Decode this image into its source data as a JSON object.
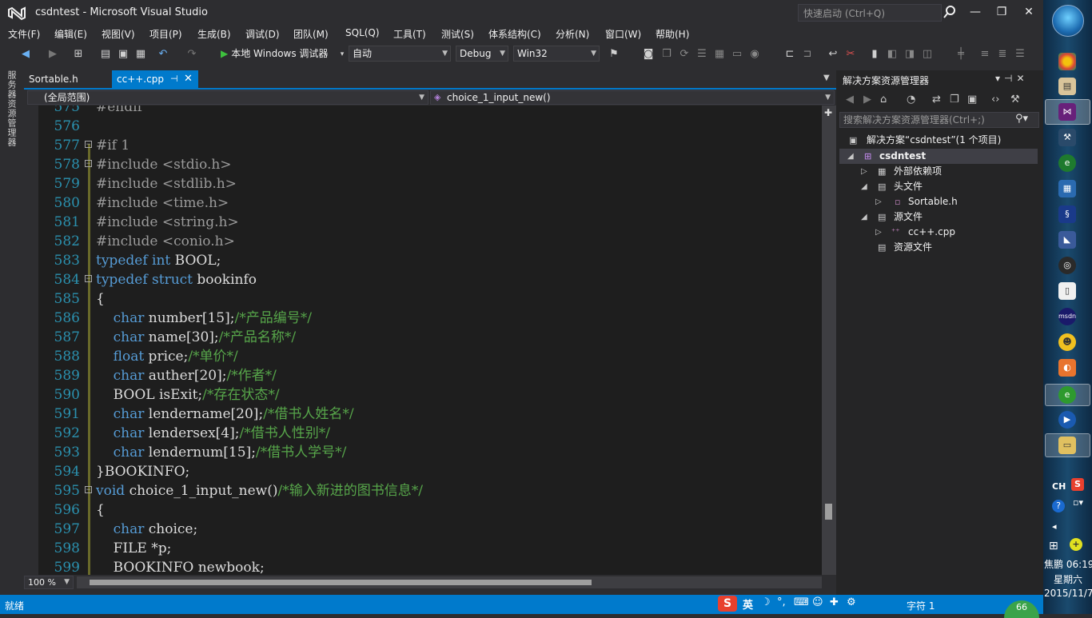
{
  "window": {
    "title": "csdntest - Microsoft Visual Studio",
    "quick_launch_placeholder": "快速启动 (Ctrl+Q)",
    "minimize": "—",
    "restore": "❐",
    "close": "✕"
  },
  "menu": [
    "文件(F)",
    "编辑(E)",
    "视图(V)",
    "项目(P)",
    "生成(B)",
    "调试(D)",
    "团队(M)",
    "SQL(Q)",
    "工具(T)",
    "测试(S)",
    "体系结构(C)",
    "分析(N)",
    "窗口(W)",
    "帮助(H)"
  ],
  "toolbar": {
    "run_label": "本地 Windows 调试器",
    "config_auto": "自动",
    "config_debug": "Debug",
    "config_platform": "Win32"
  },
  "left_strip": {
    "server_explorer": "服务器资源管理器"
  },
  "tabs": [
    {
      "label": "Sortable.h",
      "active": false
    },
    {
      "label": "cc++.cpp",
      "active": true
    }
  ],
  "nav": {
    "scope": "(全局范围)",
    "member": "choice_1_input_new()"
  },
  "code_lines": [
    {
      "num": "575",
      "fold": "",
      "tokens": [
        {
          "t": "#endif",
          "c": "pp"
        }
      ]
    },
    {
      "num": "576",
      "fold": "",
      "tokens": []
    },
    {
      "num": "577",
      "fold": "⊟",
      "tokens": [
        {
          "t": "#if",
          "c": "pp"
        },
        {
          "t": " 1",
          "c": "pp"
        }
      ]
    },
    {
      "num": "578",
      "fold": "⊟",
      "tokens": [
        {
          "t": "#include",
          "c": "pp"
        },
        {
          "t": " <stdio.h>",
          "c": "tr"
        }
      ]
    },
    {
      "num": "579",
      "fold": "",
      "tokens": [
        {
          "t": "#include",
          "c": "pp"
        },
        {
          "t": " <stdlib.h>",
          "c": "tr"
        }
      ]
    },
    {
      "num": "580",
      "fold": "",
      "tokens": [
        {
          "t": "#include",
          "c": "pp"
        },
        {
          "t": " <time.h>",
          "c": "tr"
        }
      ]
    },
    {
      "num": "581",
      "fold": "",
      "tokens": [
        {
          "t": "#include",
          "c": "pp"
        },
        {
          "t": " <string.h>",
          "c": "tr"
        }
      ]
    },
    {
      "num": "582",
      "fold": "",
      "tokens": [
        {
          "t": "#include",
          "c": "pp"
        },
        {
          "t": " <conio.h>",
          "c": "tr"
        }
      ]
    },
    {
      "num": "583",
      "fold": "",
      "tokens": [
        {
          "t": "typedef",
          "c": "kw"
        },
        {
          "t": " ",
          "c": "tx"
        },
        {
          "t": "int",
          "c": "kw"
        },
        {
          "t": " BOOL;",
          "c": "tx"
        }
      ]
    },
    {
      "num": "584",
      "fold": "⊟",
      "tokens": [
        {
          "t": "typedef",
          "c": "kw"
        },
        {
          "t": " ",
          "c": "tx"
        },
        {
          "t": "struct",
          "c": "kw"
        },
        {
          "t": " bookinfo",
          "c": "tx"
        }
      ]
    },
    {
      "num": "585",
      "fold": "",
      "tokens": [
        {
          "t": "{",
          "c": "tx"
        }
      ]
    },
    {
      "num": "586",
      "fold": "",
      "tokens": [
        {
          "t": "    char",
          "c": "kw"
        },
        {
          "t": " number[15];",
          "c": "tx"
        },
        {
          "t": "/*产品编号*/",
          "c": "cm"
        }
      ]
    },
    {
      "num": "587",
      "fold": "",
      "tokens": [
        {
          "t": "    char",
          "c": "kw"
        },
        {
          "t": " name[30];",
          "c": "tx"
        },
        {
          "t": "/*产品名称*/",
          "c": "cm"
        }
      ]
    },
    {
      "num": "588",
      "fold": "",
      "tokens": [
        {
          "t": "    float",
          "c": "kw"
        },
        {
          "t": " price;",
          "c": "tx"
        },
        {
          "t": "/*单价*/",
          "c": "cm"
        }
      ]
    },
    {
      "num": "589",
      "fold": "",
      "tokens": [
        {
          "t": "    char",
          "c": "kw"
        },
        {
          "t": " auther[20];",
          "c": "tx"
        },
        {
          "t": "/*作者*/",
          "c": "cm"
        }
      ]
    },
    {
      "num": "590",
      "fold": "",
      "tokens": [
        {
          "t": "    BOOL isExit;",
          "c": "tx"
        },
        {
          "t": "/*存在状态*/",
          "c": "cm"
        }
      ]
    },
    {
      "num": "591",
      "fold": "",
      "tokens": [
        {
          "t": "    char",
          "c": "kw"
        },
        {
          "t": " lendername[20];",
          "c": "tx"
        },
        {
          "t": "/*借书人姓名*/",
          "c": "cm"
        }
      ]
    },
    {
      "num": "592",
      "fold": "",
      "tokens": [
        {
          "t": "    char",
          "c": "kw"
        },
        {
          "t": " lendersex[4];",
          "c": "tx"
        },
        {
          "t": "/*借书人性别*/",
          "c": "cm"
        }
      ]
    },
    {
      "num": "593",
      "fold": "",
      "tokens": [
        {
          "t": "    char",
          "c": "kw"
        },
        {
          "t": " lendernum[15];",
          "c": "tx"
        },
        {
          "t": "/*借书人学号*/",
          "c": "cm"
        }
      ]
    },
    {
      "num": "594",
      "fold": "",
      "tokens": [
        {
          "t": "}BOOKINFO;",
          "c": "tx"
        }
      ]
    },
    {
      "num": "595",
      "fold": "⊟",
      "tokens": [
        {
          "t": "void",
          "c": "kw"
        },
        {
          "t": " choice_1_input_new()",
          "c": "tx"
        },
        {
          "t": "/*输入新进的图书信息*/",
          "c": "cm"
        }
      ]
    },
    {
      "num": "596",
      "fold": "",
      "tokens": [
        {
          "t": "{",
          "c": "tx"
        }
      ]
    },
    {
      "num": "597",
      "fold": "",
      "tokens": [
        {
          "t": "    char",
          "c": "kw"
        },
        {
          "t": " choice;",
          "c": "tx"
        }
      ]
    },
    {
      "num": "598",
      "fold": "",
      "tokens": [
        {
          "t": "    FILE *p;",
          "c": "tx"
        }
      ]
    },
    {
      "num": "599",
      "fold": "",
      "tokens": [
        {
          "t": "    BOOKINFO newbook;",
          "c": "tx"
        }
      ]
    }
  ],
  "editor": {
    "zoom": "100 %"
  },
  "solution_explorer": {
    "title": "解决方案资源管理器",
    "search_placeholder": "搜索解决方案资源管理器(Ctrl+;)",
    "solution": "解决方案“csdntest”(1 个项目)",
    "project": "csdntest",
    "external_deps": "外部依赖项",
    "header_files": "头文件",
    "header_file_1": "Sortable.h",
    "source_files": "源文件",
    "source_file_1": "cc++.cpp",
    "resource_files": "资源文件"
  },
  "status": {
    "ready": "就绪",
    "chars": "字符 1",
    "ime_lang": "英",
    "badge": "66"
  },
  "taskbar": {
    "lang": "CH",
    "user": "焦鹏 06:19",
    "day": "星期六",
    "date": "2015/11/7"
  },
  "colors": {
    "accent": "#007acc",
    "editor_bg": "#1e1e1e",
    "keyword": "#569cd6",
    "comment": "#57a64a",
    "line_number": "#2b91af"
  }
}
